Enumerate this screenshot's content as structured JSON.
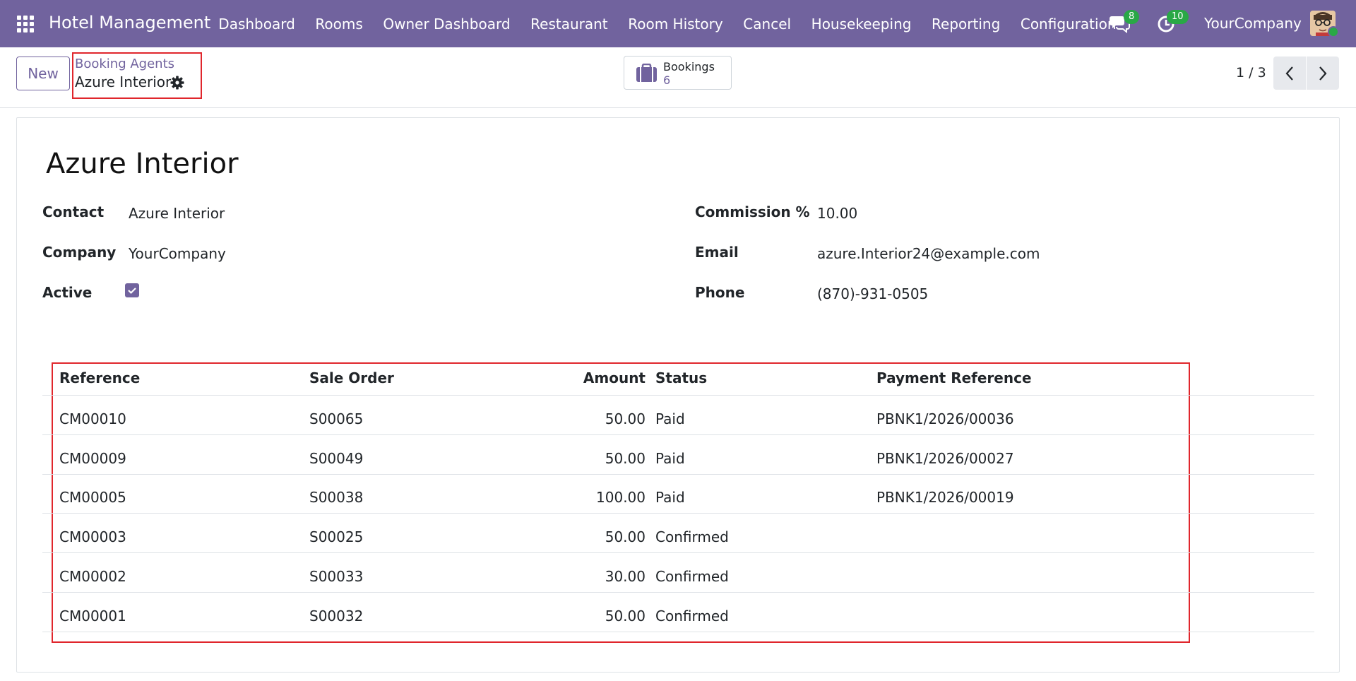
{
  "navbar": {
    "app_name": "Hotel Management",
    "menu": [
      "Dashboard",
      "Rooms",
      "Owner Dashboard",
      "Restaurant",
      "Room History",
      "Cancel",
      "Housekeeping",
      "Reporting",
      "Configuration"
    ],
    "messages_count": "8",
    "activities_count": "10",
    "company": "YourCompany"
  },
  "control_panel": {
    "new_label": "New",
    "breadcrumb_parent": "Booking Agents",
    "breadcrumb_current": "Azure Interior",
    "smart_button_label": "Bookings",
    "smart_button_value": "6",
    "pager": "1 / 3"
  },
  "form": {
    "title": "Azure Interior",
    "labels": {
      "contact": "Contact",
      "company": "Company",
      "active": "Active",
      "commission": "Commission %",
      "email": "Email",
      "phone": "Phone"
    },
    "values": {
      "contact": "Azure Interior",
      "company": "YourCompany",
      "active": true,
      "commission": "10.00",
      "email": "azure.Interior24@example.com",
      "phone": "(870)-931-0505"
    }
  },
  "table": {
    "headers": {
      "reference": "Reference",
      "sale_order": "Sale Order",
      "amount": "Amount",
      "status": "Status",
      "payment_reference": "Payment Reference"
    },
    "rows": [
      {
        "reference": "CM00010",
        "sale_order": "S00065",
        "amount": "50.00",
        "status": "Paid",
        "payment_reference": "PBNK1/2026/00036"
      },
      {
        "reference": "CM00009",
        "sale_order": "S00049",
        "amount": "50.00",
        "status": "Paid",
        "payment_reference": "PBNK1/2026/00027"
      },
      {
        "reference": "CM00005",
        "sale_order": "S00038",
        "amount": "100.00",
        "status": "Paid",
        "payment_reference": "PBNK1/2026/00019"
      },
      {
        "reference": "CM00003",
        "sale_order": "S00025",
        "amount": "50.00",
        "status": "Confirmed",
        "payment_reference": ""
      },
      {
        "reference": "CM00002",
        "sale_order": "S00033",
        "amount": "30.00",
        "status": "Confirmed",
        "payment_reference": ""
      },
      {
        "reference": "CM00001",
        "sale_order": "S00032",
        "amount": "50.00",
        "status": "Confirmed",
        "payment_reference": ""
      }
    ]
  },
  "colors": {
    "navbar": "#71639e",
    "accent": "#71639e",
    "badge": "#29a846",
    "highlight_box": "#e0262c"
  }
}
